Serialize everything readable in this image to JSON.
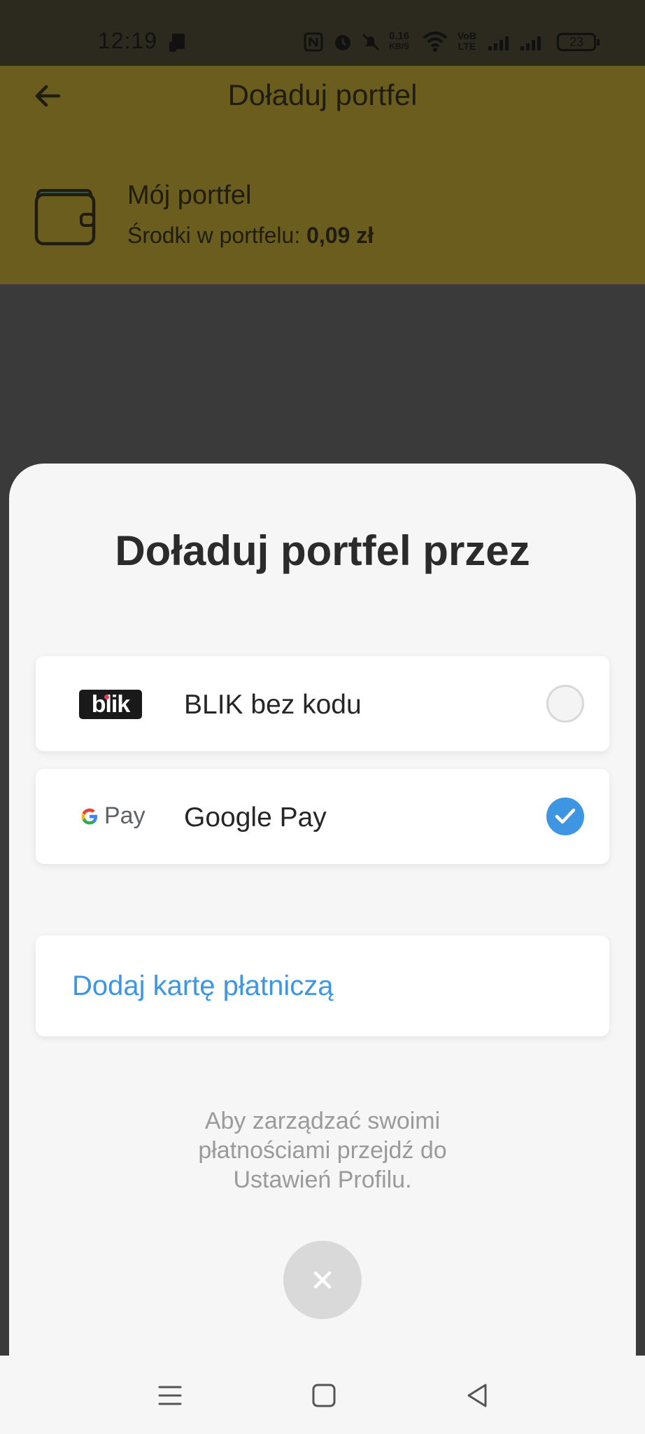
{
  "status_bar": {
    "time": "12:19",
    "net_speed_value": "0.16",
    "net_speed_unit": "KB/S",
    "volte_top": "VoB",
    "volte_bottom": "LTE",
    "battery": "23"
  },
  "header": {
    "title": "Doładuj portfel",
    "wallet_name": "Mój portfel",
    "balance_label": "Środki w portfelu:",
    "balance_value": "0,09 zł"
  },
  "sheet": {
    "title": "Doładuj portfel przez",
    "options": [
      {
        "label": "BLIK bez kodu",
        "logo_text": "blik",
        "selected": false
      },
      {
        "label": "Google Pay",
        "logo_text": "Pay",
        "selected": true
      }
    ],
    "add_card_label": "Dodaj kartę płatniczą",
    "hint": "Aby zarządzać swoimi płatnościami przejdź do Ustawień Profilu."
  },
  "colors": {
    "accent_blue": "#3e96e3",
    "header_dimmed": "#6b5d1d",
    "sheet_bg": "#f6f6f6"
  }
}
